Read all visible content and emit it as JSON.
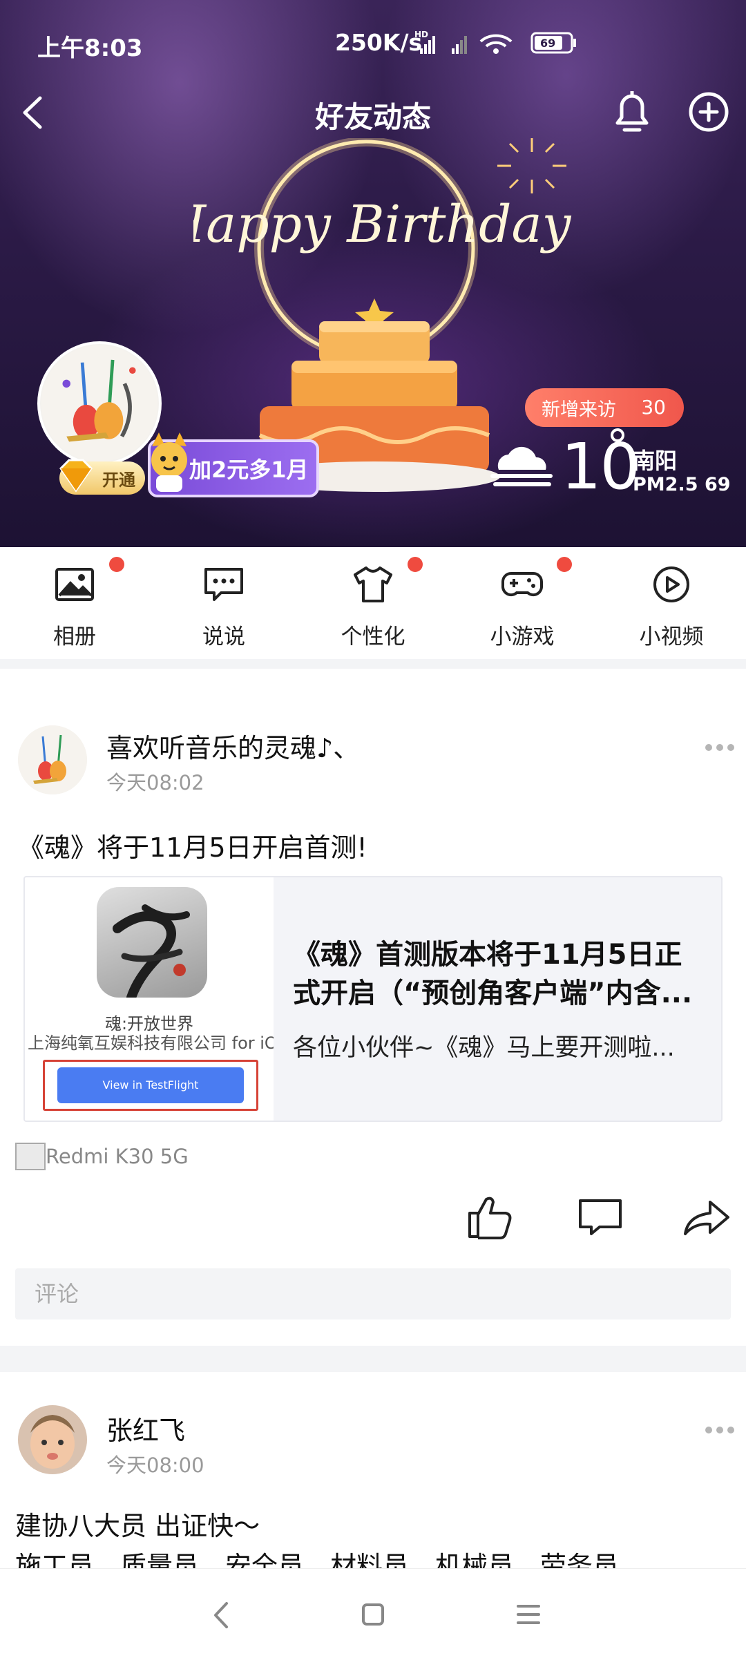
{
  "status_bar": {
    "time": "上午8:03",
    "network_speed": "250K/s",
    "battery": "69"
  },
  "header": {
    "title": "好友动态"
  },
  "banner": {
    "birthday_text": "Happy Birthday",
    "vip_label": "开通",
    "promo_label": "加2元多1月",
    "visitors_label": "新增来访",
    "visitors_count": "30",
    "weather": {
      "temperature": "10",
      "city": "南阳",
      "pm_label": "PM2.5",
      "aqi": "69"
    }
  },
  "quick_nav": [
    {
      "label": "相册",
      "icon": "photo-icon",
      "badge": true
    },
    {
      "label": "说说",
      "icon": "chat-bubble-icon",
      "badge": false
    },
    {
      "label": "个性化",
      "icon": "tshirt-icon",
      "badge": true
    },
    {
      "label": "小游戏",
      "icon": "gamepad-icon",
      "badge": true
    },
    {
      "label": "小视频",
      "icon": "play-circle-icon",
      "badge": false
    }
  ],
  "posts": [
    {
      "author": "喜欢听音乐的灵魂♪、",
      "time": "今天08:02",
      "text": "《魂》将于11月5日开启首测!",
      "share": {
        "app_name": "魂:开放世界",
        "company": "上海纯氧互娱科技有限公司 for iOS",
        "button": "View in TestFlight",
        "title_line1": "《魂》首测版本将于11月5日正",
        "title_line2": "式开启（“预创角客户端”内含...",
        "description": "各位小伙伴~《魂》马上要开测啦..."
      },
      "device": "Redmi K30 5G",
      "comment_placeholder": "评论"
    },
    {
      "author": "张红飞",
      "time": "今天08:00",
      "text_line1": "建协八大员 出证快～",
      "text_line2": "施工员、质量员、安全员、材料员、机械员、劳务员、"
    }
  ],
  "colors": {
    "accent_red": "#ef4b3f",
    "visitor_pill": "#f0574c",
    "promo_purple": "#8a5ae6",
    "link_blue": "#4a7cf2"
  }
}
